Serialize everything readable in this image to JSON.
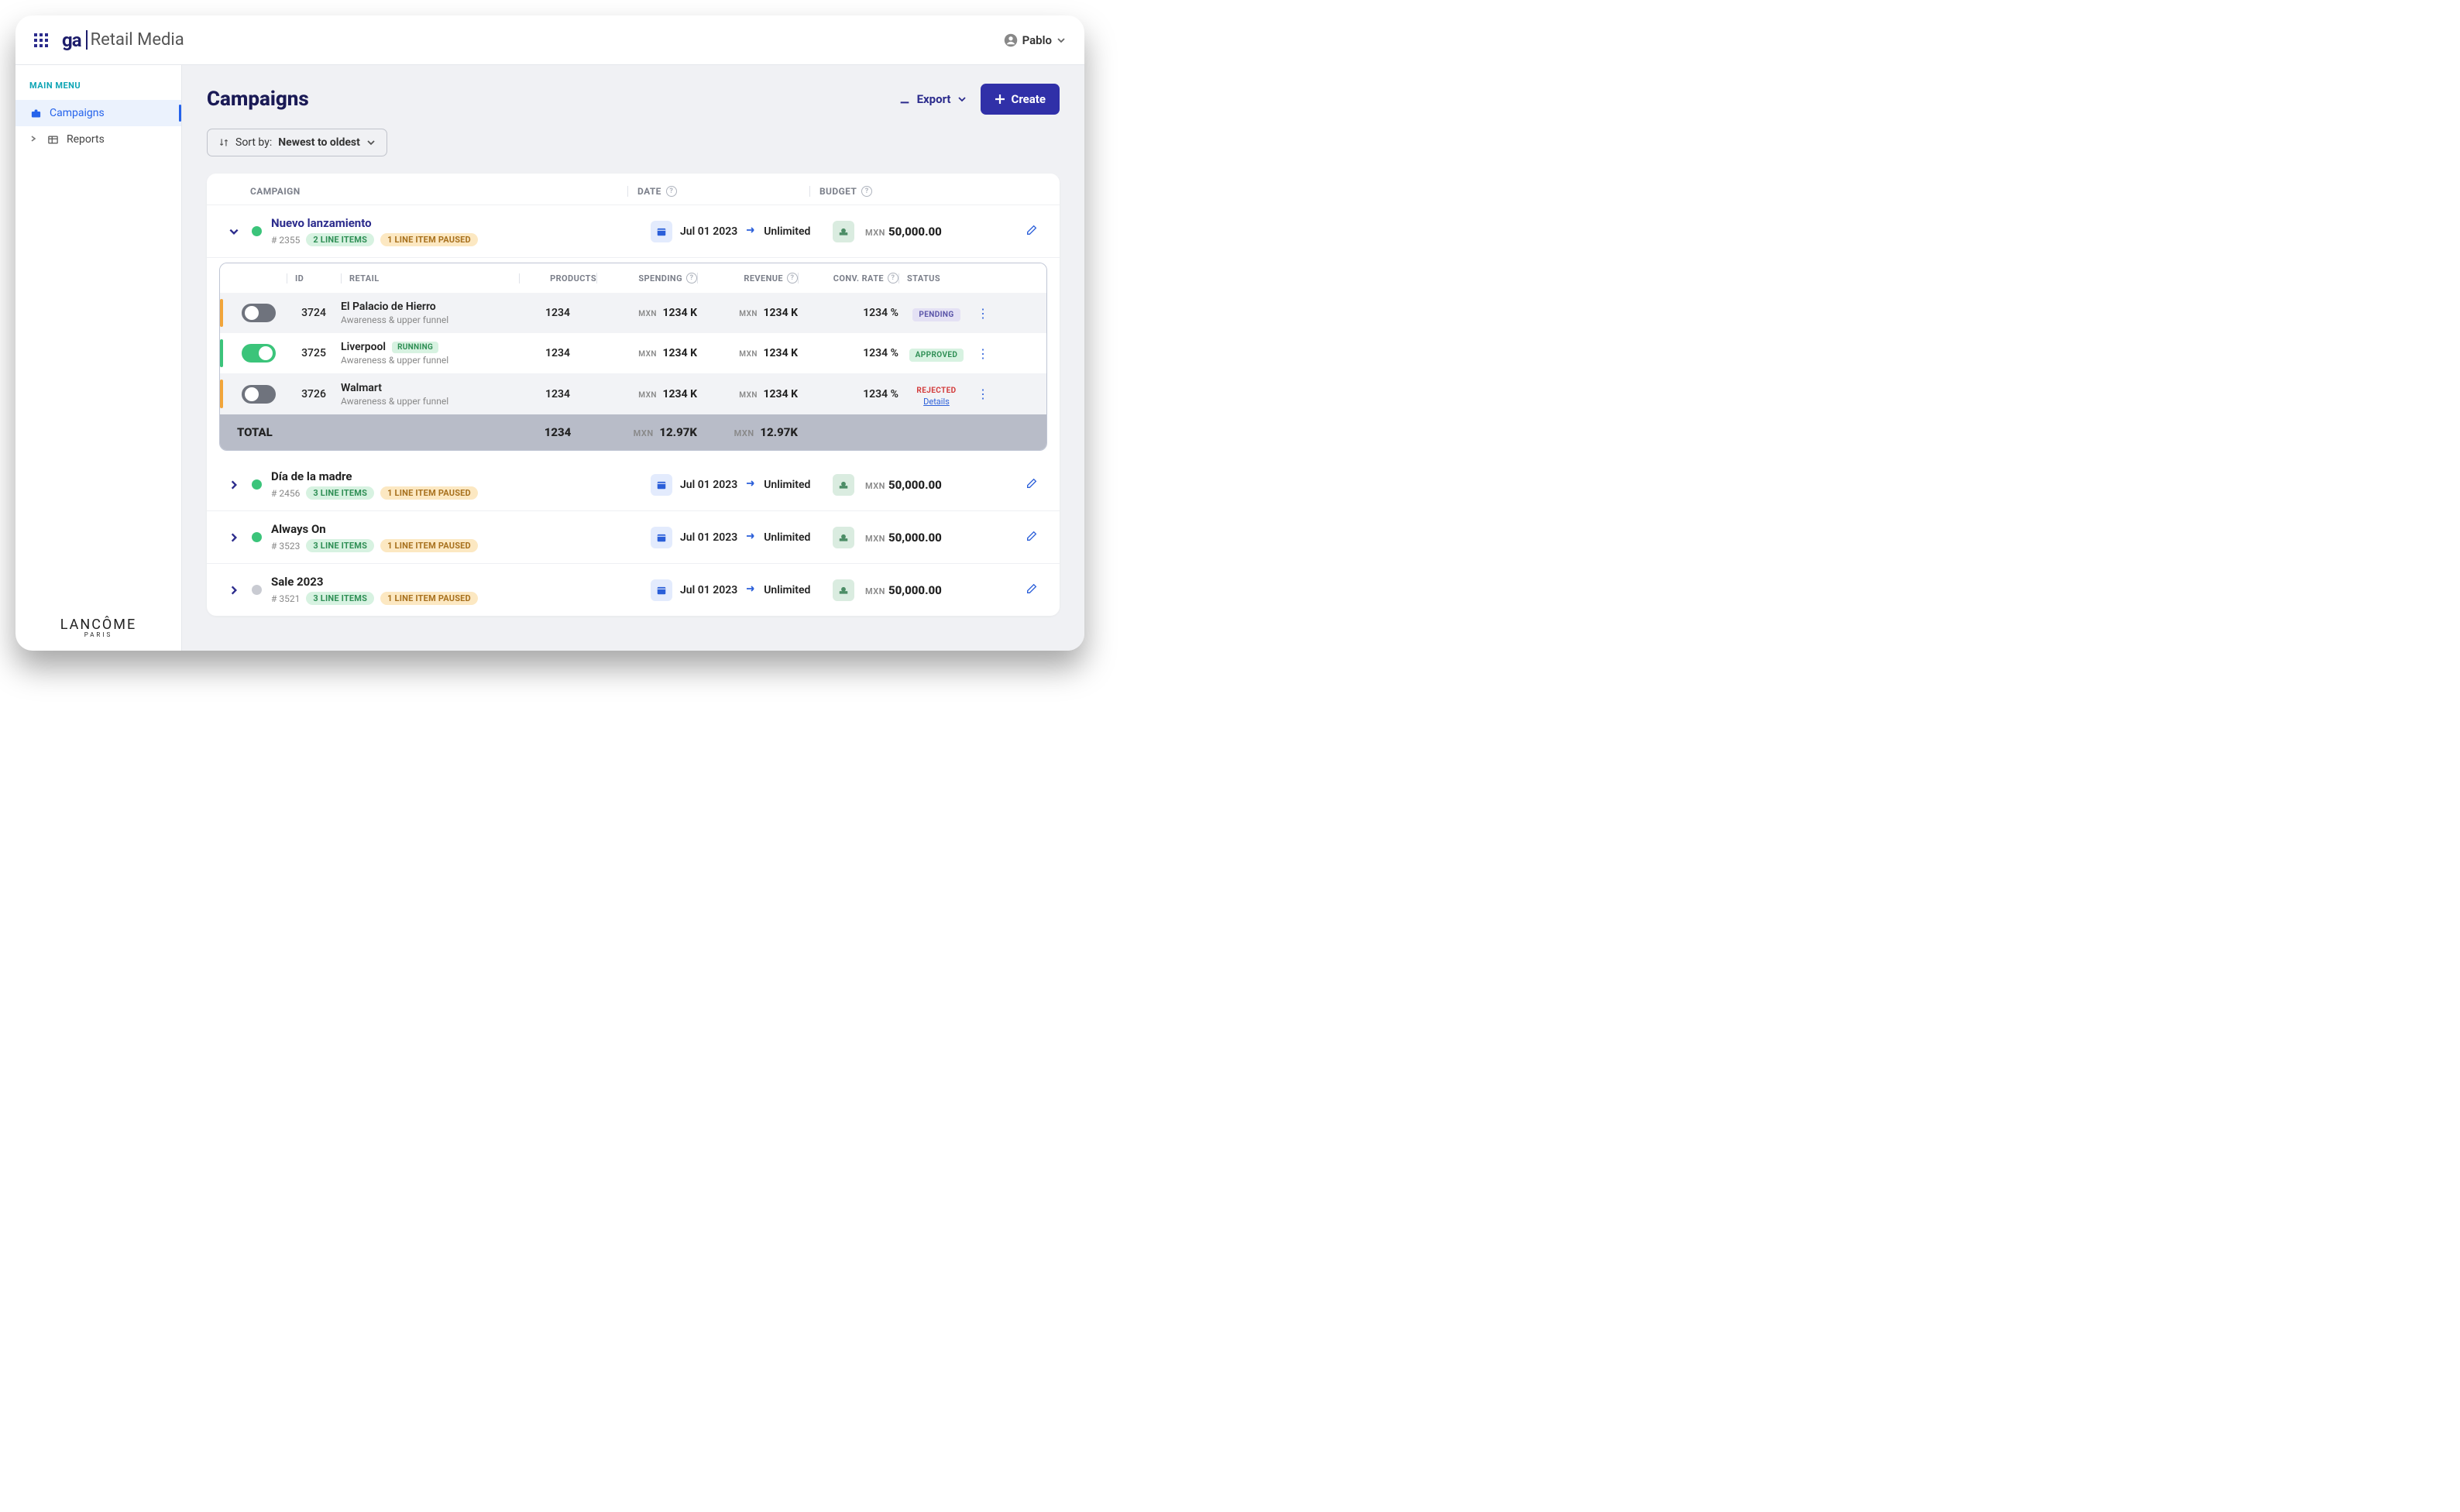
{
  "header": {
    "logo_mark": "ga",
    "logo_text": "Retail Media",
    "user_name": "Pablo"
  },
  "sidebar": {
    "heading": "MAIN MENU",
    "items": [
      {
        "label": "Campaigns",
        "active": true
      },
      {
        "label": "Reports",
        "active": false
      }
    ],
    "brand": "LANCÔME",
    "brand_sub": "PARIS"
  },
  "page": {
    "title": "Campaigns",
    "export_label": "Export",
    "create_label": "Create",
    "sort_prefix": "Sort by:",
    "sort_value": "Newest to oldest"
  },
  "columns": {
    "campaign": "CAMPAIGN",
    "date": "DATE",
    "budget": "BUDGET"
  },
  "campaigns": [
    {
      "name": "Nuevo lanzamiento",
      "id": "# 2355",
      "line_items_pill": "2 LINE ITEMS",
      "paused_pill": "1 LINE ITEM PAUSED",
      "date_start": "Jul 01 2023",
      "date_end": "Unlimited",
      "currency": "MXN",
      "budget": "50,000.00",
      "expanded": true,
      "dot": "green"
    },
    {
      "name": "Día de la madre",
      "id": "# 2456",
      "line_items_pill": "3 LINE ITEMS",
      "paused_pill": "1 LINE ITEM PAUSED",
      "date_start": "Jul 01 2023",
      "date_end": "Unlimited",
      "currency": "MXN",
      "budget": "50,000.00",
      "expanded": false,
      "dot": "green"
    },
    {
      "name": "Always On",
      "id": "# 3523",
      "line_items_pill": "3 LINE ITEMS",
      "paused_pill": "1 LINE ITEM PAUSED",
      "date_start": "Jul 01 2023",
      "date_end": "Unlimited",
      "currency": "MXN",
      "budget": "50,000.00",
      "expanded": false,
      "dot": "green"
    },
    {
      "name": "Sale 2023",
      "id": "# 3521",
      "line_items_pill": "3 LINE ITEMS",
      "paused_pill": "1 LINE ITEM PAUSED",
      "date_start": "Jul 01 2023",
      "date_end": "Unlimited",
      "currency": "MXN",
      "budget": "50,000.00",
      "expanded": false,
      "dot": "grey"
    }
  ],
  "nested_columns": {
    "id": "ID",
    "retail": "RETAIL",
    "products": "PRODUCTS",
    "spending": "SPENDING",
    "revenue": "REVENUE",
    "conv_rate": "CONV. RATE",
    "status": "STATUS"
  },
  "line_items": [
    {
      "id": "3724",
      "retail": "El Palacio de Hierro",
      "sub": "Awareness & upper funnel",
      "running": false,
      "toggle_on": false,
      "bar": "orange",
      "products": "1234",
      "spending": "1234 K",
      "revenue": "1234 K",
      "conv": "1234 %",
      "status": "PENDING",
      "status_kind": "pending"
    },
    {
      "id": "3725",
      "retail": "Liverpool",
      "sub": "Awareness & upper funnel",
      "running": true,
      "running_label": "RUNNING",
      "toggle_on": true,
      "bar": "green",
      "products": "1234",
      "spending": "1234 K",
      "revenue": "1234 K",
      "conv": "1234 %",
      "status": "APPROVED",
      "status_kind": "approved"
    },
    {
      "id": "3726",
      "retail": "Walmart",
      "sub": "Awareness & upper funnel",
      "running": false,
      "toggle_on": false,
      "bar": "orange",
      "products": "1234",
      "spending": "1234 K",
      "revenue": "1234 K",
      "conv": "1234 %",
      "status": "REJECTED",
      "status_kind": "rejected",
      "details": "Details"
    }
  ],
  "totals": {
    "label": "TOTAL",
    "products": "1234",
    "spending": "12.97K",
    "revenue": "12.97K",
    "currency": "MXN"
  }
}
